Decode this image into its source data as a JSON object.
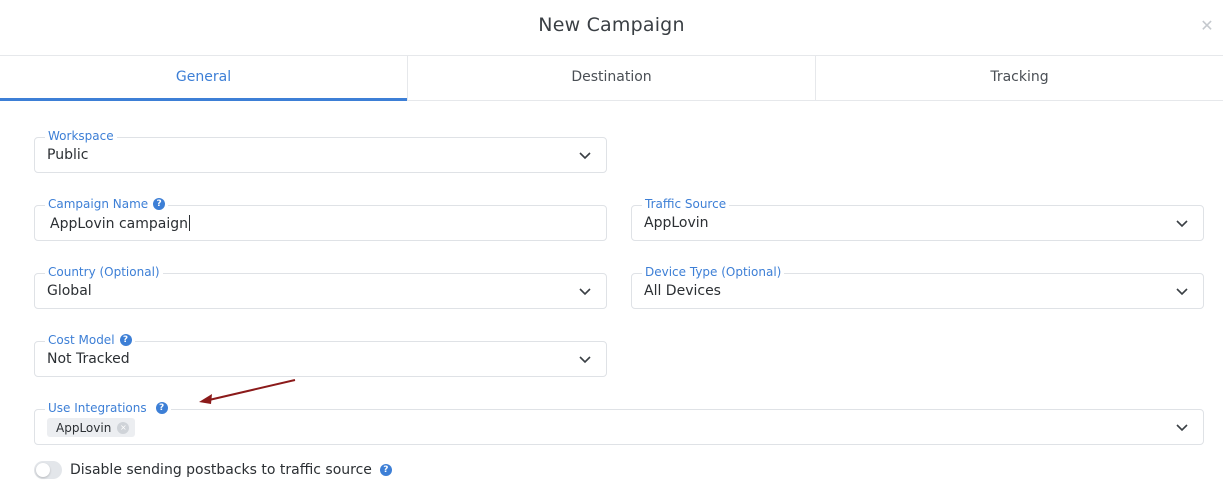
{
  "modal": {
    "title": "New Campaign",
    "close_glyph": "✕"
  },
  "tabs": [
    {
      "label": "General",
      "active": true
    },
    {
      "label": "Destination",
      "active": false
    },
    {
      "label": "Tracking",
      "active": false
    }
  ],
  "form": {
    "workspace": {
      "label": "Workspace",
      "value": "Public"
    },
    "campaign_name": {
      "label": "Campaign Name",
      "value": "AppLovin campaign"
    },
    "traffic_source": {
      "label": "Traffic Source",
      "value": "AppLovin"
    },
    "country": {
      "label": "Country (Optional)",
      "value": "Global"
    },
    "device_type": {
      "label": "Device Type (Optional)",
      "value": "All Devices"
    },
    "cost_model": {
      "label": "Cost Model",
      "value": "Not Tracked"
    },
    "integrations": {
      "label": "Use Integrations",
      "chips": [
        "AppLovin"
      ]
    },
    "postbacks_toggle": {
      "label": "Disable sending postbacks to traffic source",
      "on": false
    }
  },
  "icons": {
    "help": "?",
    "chip_remove": "×",
    "chevron": "chevron-down-icon"
  },
  "colors": {
    "accent": "#3d7fd6",
    "annotation_arrow": "#8b1a1a"
  }
}
